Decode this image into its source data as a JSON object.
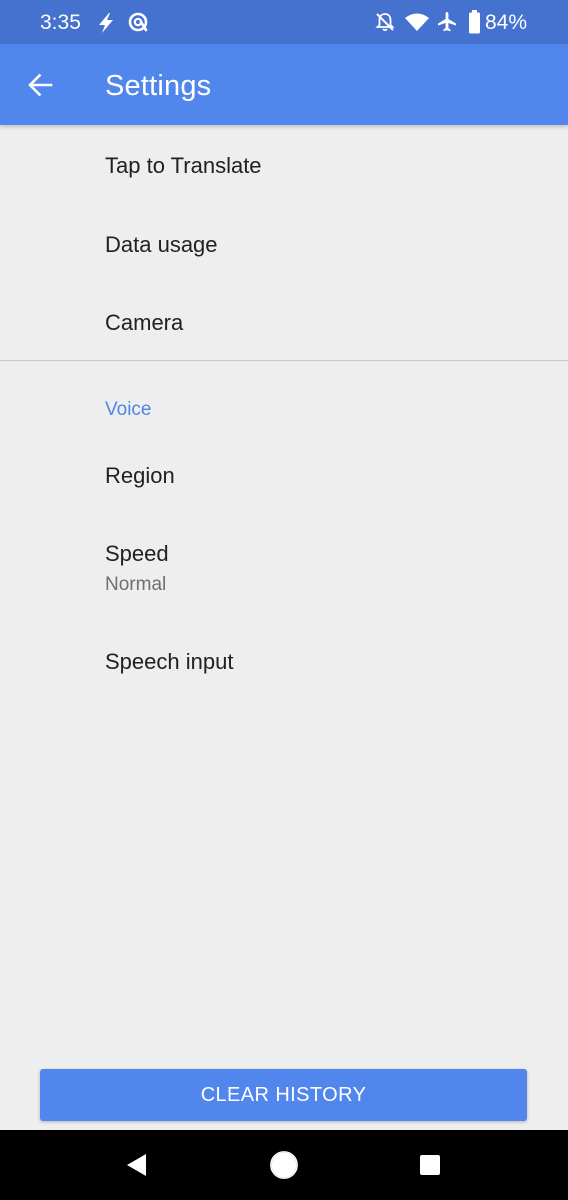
{
  "status_bar": {
    "time": "3:35",
    "battery": "84%",
    "icons": [
      "flash-icon",
      "data-saver-icon",
      "notifications-off-icon",
      "wifi-icon",
      "airplane-mode-icon",
      "battery-icon"
    ]
  },
  "app_bar": {
    "title": "Settings",
    "back_icon": "arrow-back-icon"
  },
  "settings": {
    "general": [
      {
        "label": "Tap to Translate"
      },
      {
        "label": "Data usage"
      },
      {
        "label": "Camera"
      }
    ],
    "voice_section": {
      "header": "Voice",
      "items": [
        {
          "label": "Region"
        },
        {
          "label": "Speed",
          "summary": "Normal"
        },
        {
          "label": "Speech input"
        }
      ]
    }
  },
  "clear_history_button": "CLEAR HISTORY",
  "nav_bar": {
    "icons": [
      "back-triangle-icon",
      "home-circle-icon",
      "recents-square-icon"
    ]
  },
  "colors": {
    "status_bar": "#4572cf",
    "app_bar": "#5186ec",
    "background": "#eeeeee",
    "section_header": "#4f85e6",
    "nav_bar": "#000000"
  }
}
